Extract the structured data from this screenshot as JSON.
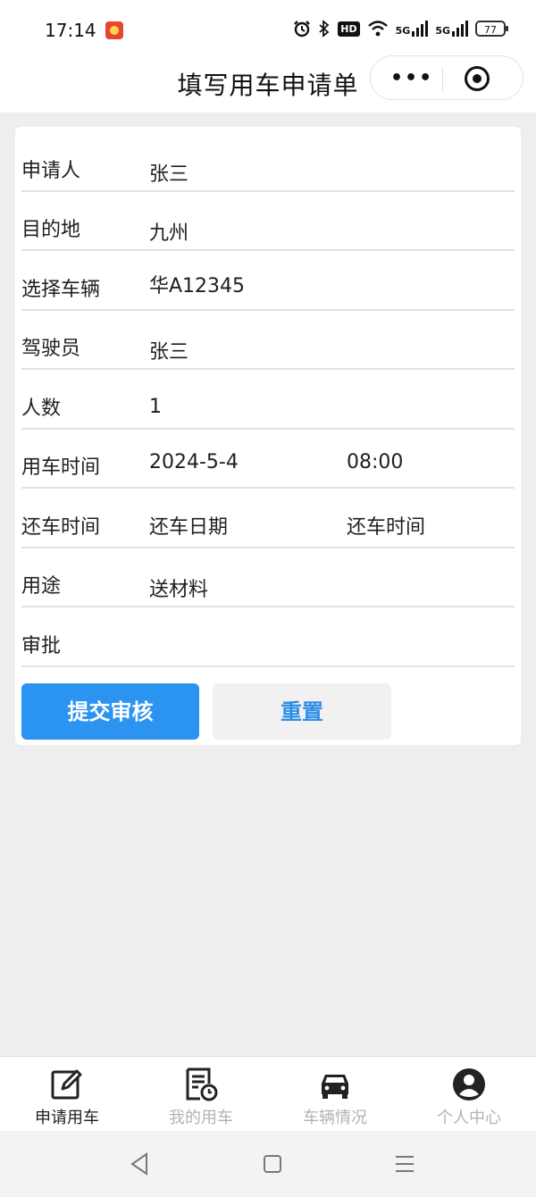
{
  "status_bar": {
    "time": "17:14",
    "icons": [
      "app-icon",
      "alarm-icon",
      "bluetooth-icon",
      "hd-icon",
      "wifi-icon",
      "5g-signal-icon",
      "5g-signal-icon"
    ],
    "hd_label": "HD",
    "signal1_label": "5G",
    "signal2_label": "5G",
    "battery": "77"
  },
  "title_bar": {
    "title": "填写用车申请单",
    "more_symbol": "•••"
  },
  "form": {
    "rows": [
      {
        "label": "申请人",
        "value": "张三"
      },
      {
        "label": "目的地",
        "value": "九州"
      },
      {
        "label": "选择车辆",
        "value": "华A12345"
      },
      {
        "label": "驾驶员",
        "value": "张三"
      },
      {
        "label": "人数",
        "value": "1"
      },
      {
        "label": "用车时间",
        "value": "2024-5-4",
        "value2": "08:00"
      },
      {
        "label": "还车时间",
        "value": "还车日期",
        "value2": "还车时间"
      },
      {
        "label": "用途",
        "value": "送材料"
      },
      {
        "label": "审批",
        "value": ""
      }
    ],
    "submit_label": "提交审核",
    "reset_label": "重置"
  },
  "tabs": [
    {
      "label": "申请用车",
      "icon": "edit-icon",
      "active": true
    },
    {
      "label": "我的用车",
      "icon": "document-clock-icon",
      "active": false
    },
    {
      "label": "车辆情况",
      "icon": "car-icon",
      "active": false
    },
    {
      "label": "个人中心",
      "icon": "user-icon",
      "active": false
    }
  ],
  "colors": {
    "primary": "#2b93f0",
    "reset_text": "#2b8ee6",
    "background": "#eeeeee",
    "tab_inactive": "#b3b3b3"
  }
}
